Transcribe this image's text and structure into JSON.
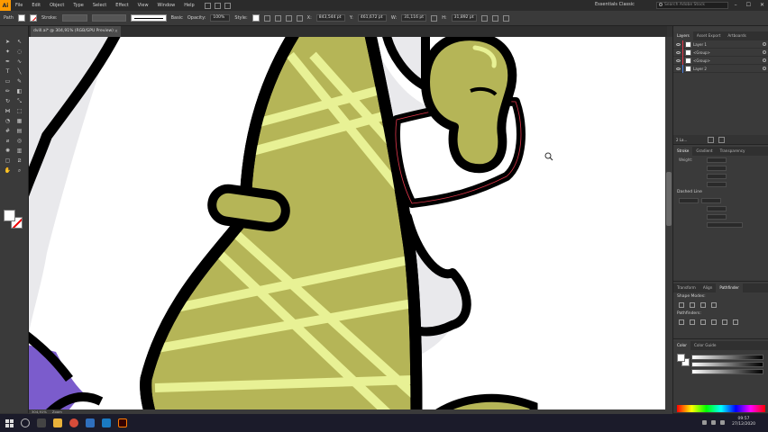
{
  "menubar": {
    "logo": "Ai",
    "items": [
      "File",
      "Edit",
      "Object",
      "Type",
      "Select",
      "Effect",
      "View",
      "Window",
      "Help"
    ],
    "workspace": "Essentials Classic",
    "search_placeholder": "Search Adobe Stock"
  },
  "controlbar": {
    "mode_label": "Path",
    "stroke_label": "Stroke:",
    "brush_label": "Basic",
    "opacity_label": "Opacity:",
    "opacity_value": "100%",
    "style_label": "Style:",
    "x_value": "843,544 pt",
    "y_value": "461,672 pt",
    "w_value": "31,116 pt",
    "h_value": "31,892 pt"
  },
  "document": {
    "tab_title": "dvill.ai* @ 304,91% (RGB/GPU Preview)",
    "zoom": "304,91%",
    "status_tool": "Zoom"
  },
  "panels": {
    "layers_tabs": [
      "Layers",
      "Asset Export",
      "Artboards"
    ],
    "layers": [
      "Layer 1",
      "<Group>",
      "<Group>",
      "Layer 2"
    ],
    "layers_count": "2 La...",
    "stroke_tabs": [
      "Stroke",
      "Gradient",
      "Transparency"
    ],
    "weight_label": "Weight:",
    "dashed_label": "Dashed Line",
    "pathfinder_tabs": [
      "Transform",
      "Align",
      "Pathfinder"
    ],
    "shape_modes": "Shape Modes:",
    "pathfinders": "Pathfinders:",
    "color_tabs": [
      "Color",
      "Color Guide"
    ]
  },
  "taskbar": {
    "time": "09:57",
    "date": "27/12/2020"
  },
  "colors": {
    "olive": "#b5b557",
    "stripe": "#e8f195",
    "purple": "#7b5ccc",
    "selection": "#e0364a"
  }
}
